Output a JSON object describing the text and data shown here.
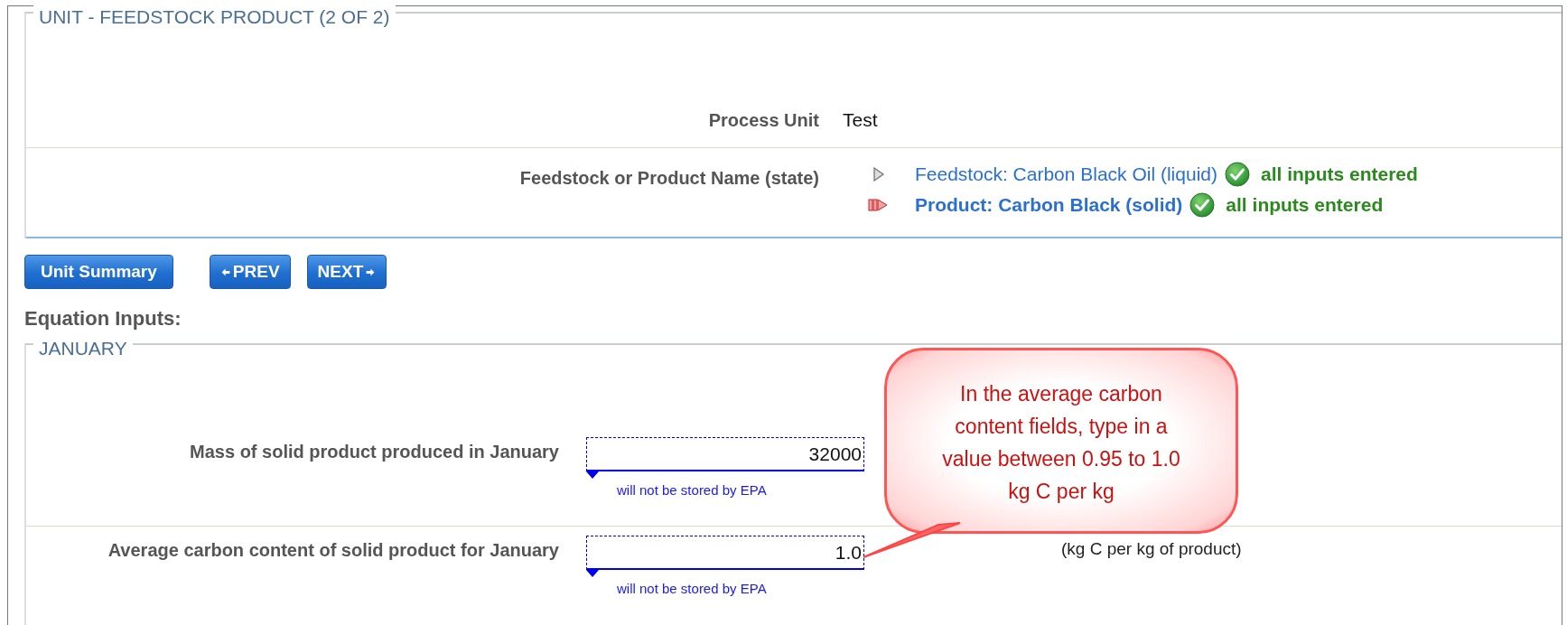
{
  "unit_panel": {
    "title": "UNIT - FEEDSTOCK PRODUCT (2 OF 2)",
    "process_unit": {
      "label": "Process Unit",
      "value": "Test"
    },
    "feedstock_label": "Feedstock or Product Name (state)",
    "items": [
      {
        "name": "Feedstock: Carbon Black Oil (liquid)",
        "status": "all inputs entered",
        "selected": false
      },
      {
        "name": "Product: Carbon Black (solid)",
        "status": "all inputs entered",
        "selected": true
      }
    ]
  },
  "buttons": [
    {
      "kind": "summary",
      "label": "Unit Summary"
    },
    {
      "kind": "prev",
      "label": "PREV"
    },
    {
      "kind": "next",
      "label": "NEXT"
    }
  ],
  "section_title": "Equation Inputs:",
  "month_panel": {
    "title": "JANUARY",
    "fields": [
      {
        "label": "Mass of solid product produced in January",
        "value": "32000",
        "hint": "will not be stored by EPA"
      },
      {
        "label": "Average carbon content of solid product for January",
        "value": "1.0",
        "hint": "will not be stored by EPA",
        "unit": "(kg C per kg of product)"
      }
    ]
  },
  "callout": {
    "text": "In the average carbon content fields, type in a value between 0.95 to 1.0 kg C per kg"
  }
}
